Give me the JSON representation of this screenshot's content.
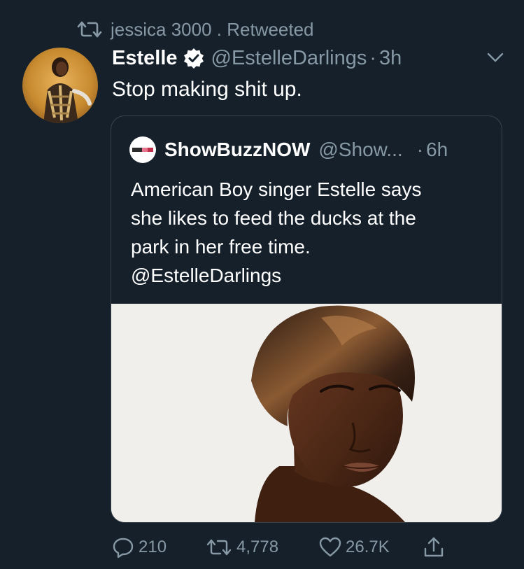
{
  "retweet": {
    "icon": "retweet-icon",
    "text": "jessica 3000 . Retweeted"
  },
  "tweet": {
    "avatar_icon": "user-avatar",
    "display_name": "Estelle",
    "verified_icon": "verified-badge-icon",
    "handle": "@EstelleDarlings",
    "separator": "·",
    "time": "3h",
    "text": "Stop making shit up.",
    "menu_icon": "chevron-down-icon"
  },
  "quote": {
    "avatar_icon": "showbuzz-logo",
    "display_name": "ShowBuzzNOW",
    "handle": "@Show...",
    "separator": "·",
    "time": "6h",
    "text_lines": [
      "American Boy singer Estelle says",
      "she likes to feed the ducks at the",
      "park in her free time.",
      "@EstelleDarlings"
    ],
    "media": "portrait-photo"
  },
  "actions": {
    "reply_count": "210",
    "retweet_count": "4,778",
    "like_count": "26.7K",
    "share_icon": "share-icon"
  },
  "colors": {
    "background": "#15202b",
    "secondary_text": "#8899a6",
    "border": "#38444d",
    "verified_badge": "#ffffff"
  }
}
